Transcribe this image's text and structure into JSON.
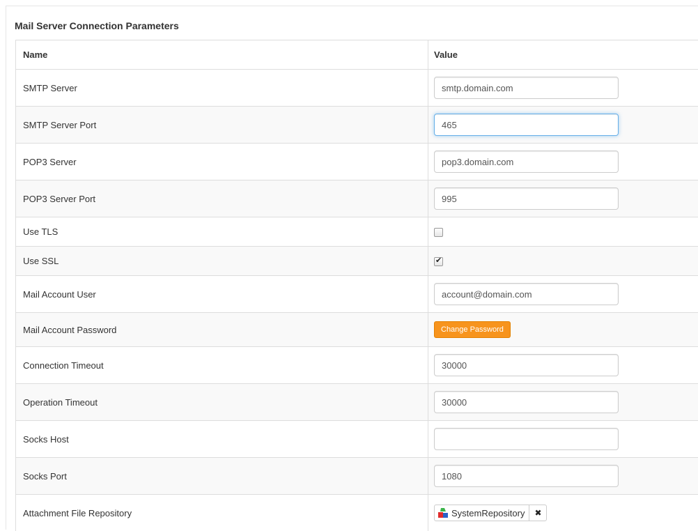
{
  "panel": {
    "title": "Mail Server Connection Parameters"
  },
  "table": {
    "headers": {
      "name": "Name",
      "value": "Value"
    },
    "rows": {
      "smtp_server": {
        "label": "SMTP Server",
        "value": "smtp.domain.com"
      },
      "smtp_port": {
        "label": "SMTP Server Port",
        "value": "465"
      },
      "pop3_server": {
        "label": "POP3 Server",
        "value": "pop3.domain.com"
      },
      "pop3_port": {
        "label": "POP3 Server Port",
        "value": "995"
      },
      "use_tls": {
        "label": "Use TLS",
        "checked": false
      },
      "use_ssl": {
        "label": "Use SSL",
        "checked": true
      },
      "mail_user": {
        "label": "Mail Account User",
        "value": "account@domain.com"
      },
      "mail_password": {
        "label": "Mail Account Password",
        "button": "Change Password"
      },
      "conn_timeout": {
        "label": "Connection Timeout",
        "value": "30000"
      },
      "op_timeout": {
        "label": "Operation Timeout",
        "value": "30000"
      },
      "socks_host": {
        "label": "Socks Host",
        "value": ""
      },
      "socks_port": {
        "label": "Socks Port",
        "value": "1080"
      },
      "attachment_repo": {
        "label": "Attachment File Repository",
        "repository": "SystemRepository",
        "icon": "repository-shapes-icon",
        "remove_icon": "close-x-icon"
      }
    }
  },
  "colors": {
    "button_orange": "#f7941d",
    "focus_blue": "#66afe9",
    "row_stripe": "#f9f9f9"
  }
}
